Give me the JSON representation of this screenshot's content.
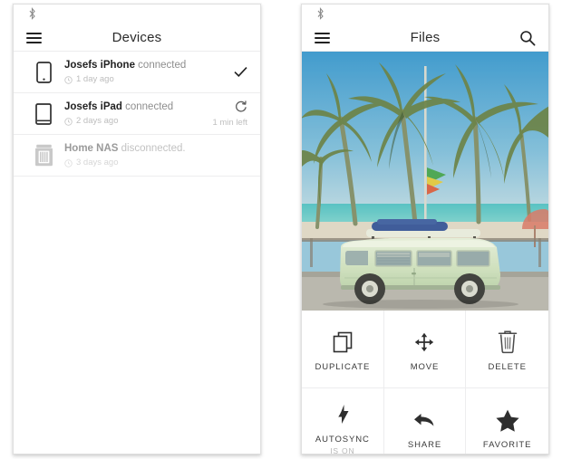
{
  "devices_panel": {
    "statusbar": {
      "bluetooth_icon": "bluetooth-icon"
    },
    "appbar": {
      "menu_icon": "hamburger-menu-icon",
      "title": "Devices"
    },
    "items": [
      {
        "icon": "phone-icon",
        "name": "Josefs iPhone",
        "state": "connected",
        "time_icon": "clock-icon",
        "time": "1 day ago",
        "status_icon": "check-icon",
        "eta": ""
      },
      {
        "icon": "tablet-icon",
        "name": "Josefs iPad",
        "state": "connected",
        "time_icon": "clock-icon",
        "time": "2 days ago",
        "status_icon": "sync-refresh-icon",
        "eta": "1 min left"
      },
      {
        "icon": "nas-server-icon",
        "name": "Home NAS",
        "state": "disconnected.",
        "time_icon": "clock-icon",
        "time": "3 days ago",
        "status_icon": "",
        "eta": ""
      }
    ]
  },
  "files_panel": {
    "statusbar": {
      "bluetooth_icon": "bluetooth-icon"
    },
    "appbar": {
      "menu_icon": "hamburger-menu-icon",
      "title": "Files",
      "search_icon": "search-icon"
    },
    "photo": {
      "alt": "Mint green vintage camper van with surfboards parked on a beach road under palm trees",
      "sky_color": "#3f9fd4",
      "van_color": "#cfe0bd",
      "sand_color": "#e2ddcf",
      "sea_color": "#4fc0c4",
      "road_color": "#b3b3ad"
    },
    "actions": [
      {
        "icon": "duplicate-icon",
        "label": "DUPLICATE",
        "sub": ""
      },
      {
        "icon": "move-arrows-icon",
        "label": "MOVE",
        "sub": ""
      },
      {
        "icon": "trash-delete-icon",
        "label": "DELETE",
        "sub": ""
      },
      {
        "icon": "autosync-bolt-icon",
        "label": "AUTOSYNC",
        "sub": "IS ON"
      },
      {
        "icon": "share-arrow-icon",
        "label": "SHARE",
        "sub": ""
      },
      {
        "icon": "favorite-star-icon",
        "label": "FAVORITE",
        "sub": ""
      }
    ]
  }
}
